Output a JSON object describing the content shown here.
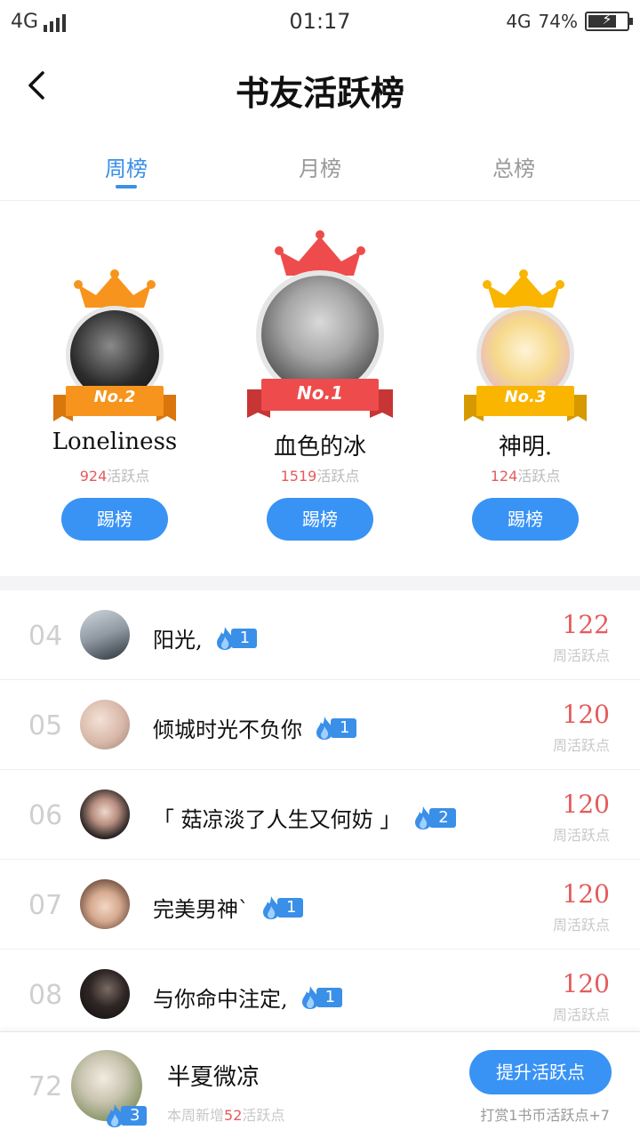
{
  "status_bar": {
    "network_left": "4G",
    "time": "01:17",
    "network_right": "4G",
    "battery_percent": "74%",
    "battery_level": 0.74,
    "charging_icon": "bolt-icon"
  },
  "header": {
    "title": "书友活跃榜",
    "back_icon": "chevron-left-icon"
  },
  "tabs": [
    {
      "label": "周榜",
      "active": true
    },
    {
      "label": "月榜",
      "active": false
    },
    {
      "label": "总榜",
      "active": false
    }
  ],
  "podium": [
    {
      "rank_label": "No.2",
      "name": "Loneliness",
      "points": "924",
      "points_unit": "活跃点",
      "button": "踢榜",
      "crown_color": "#f7941d",
      "ribbon_color": "#f7941d"
    },
    {
      "rank_label": "No.1",
      "name": "血色的冰",
      "points": "1519",
      "points_unit": "活跃点",
      "button": "踢榜",
      "crown_color": "#ee4c4c",
      "ribbon_color": "#ee4c4c"
    },
    {
      "rank_label": "No.3",
      "name": "神明.",
      "points": "124",
      "points_unit": "活跃点",
      "button": "踢榜",
      "crown_color": "#f9b500",
      "ribbon_color": "#f9b500"
    }
  ],
  "list": [
    {
      "rank": "04",
      "name": "阳光,",
      "level": "1",
      "score": "122",
      "score_label": "周活跃点"
    },
    {
      "rank": "05",
      "name": "倾城时光不负你",
      "level": "1",
      "score": "120",
      "score_label": "周活跃点"
    },
    {
      "rank": "06",
      "name": "「 菇凉淡了人生又何妨 」",
      "level": "2",
      "score": "120",
      "score_label": "周活跃点"
    },
    {
      "rank": "07",
      "name": "完美男神`",
      "level": "1",
      "score": "120",
      "score_label": "周活跃点"
    },
    {
      "rank": "08",
      "name": "与你命中注定,",
      "level": "1",
      "score": "120",
      "score_label": "周活跃点"
    }
  ],
  "my_rank": {
    "rank": "72",
    "name": "半夏微凉",
    "level": "3",
    "sub_prefix": "本周新增",
    "sub_points": "52",
    "sub_suffix": "活跃点",
    "boost_button": "提升活跃点",
    "tip": "打赏1书币活跃点+7"
  },
  "colors": {
    "accent": "#3a8fe8",
    "button": "#3993f5",
    "score_red": "#e45b5b"
  }
}
